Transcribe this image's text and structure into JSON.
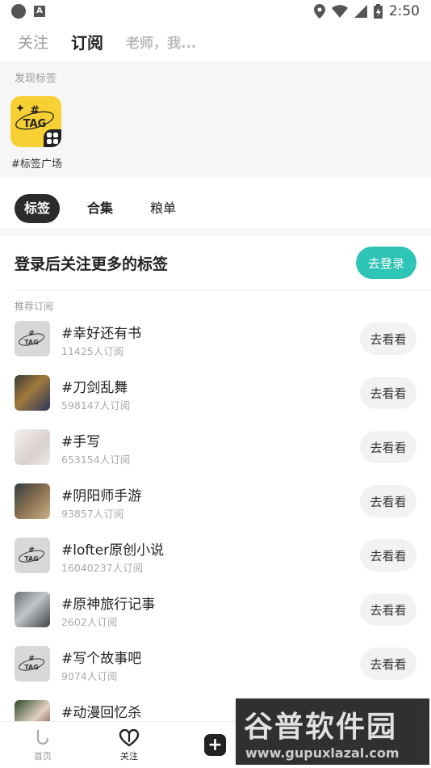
{
  "status_bar": {
    "time": "2:50",
    "icons": [
      "app-icon",
      "a-icon",
      "location-icon",
      "wifi-icon",
      "signal-icon",
      "battery-icon"
    ]
  },
  "top_nav": {
    "tabs": [
      "关注",
      "订阅"
    ],
    "search_placeholder": "老师，我..."
  },
  "discover": {
    "title": "发现标签",
    "tag_plaza_label": "#标签广场",
    "tag_icon_text": "TAG",
    "tag_icon_hash": "#"
  },
  "segments": [
    "标签",
    "合集",
    "粮单"
  ],
  "login": {
    "prompt": "登录后关注更多的标签",
    "button": "去登录"
  },
  "recommend": {
    "title": "推荐订阅",
    "button_label": "去看看",
    "items": [
      {
        "name": "#幸好还有书",
        "subs": "11425人订阅",
        "thumb": "tag"
      },
      {
        "name": "#刀剑乱舞",
        "subs": "598147人订阅",
        "thumb": "art1"
      },
      {
        "name": "#手写",
        "subs": "653154人订阅",
        "thumb": "art2"
      },
      {
        "name": "#阴阳师手游",
        "subs": "93857人订阅",
        "thumb": "art3"
      },
      {
        "name": "#lofter原创小说",
        "subs": "16040237人订阅",
        "thumb": "tag"
      },
      {
        "name": "#原神旅行记事",
        "subs": "2602人订阅",
        "thumb": "art4"
      },
      {
        "name": "#写个故事吧",
        "subs": "9074人订阅",
        "thumb": "tag"
      },
      {
        "name": "#动漫回忆杀",
        "subs": "",
        "thumb": "art5"
      }
    ]
  },
  "bottom_nav": {
    "home": "首页",
    "follow": "关注"
  },
  "watermark": {
    "text": "谷普软件园",
    "url": "www.gupuxlazal.com"
  },
  "colors": {
    "accent": "#2ec4b6",
    "tag_yellow": "#f7d034",
    "dark": "#2b2b2b"
  }
}
